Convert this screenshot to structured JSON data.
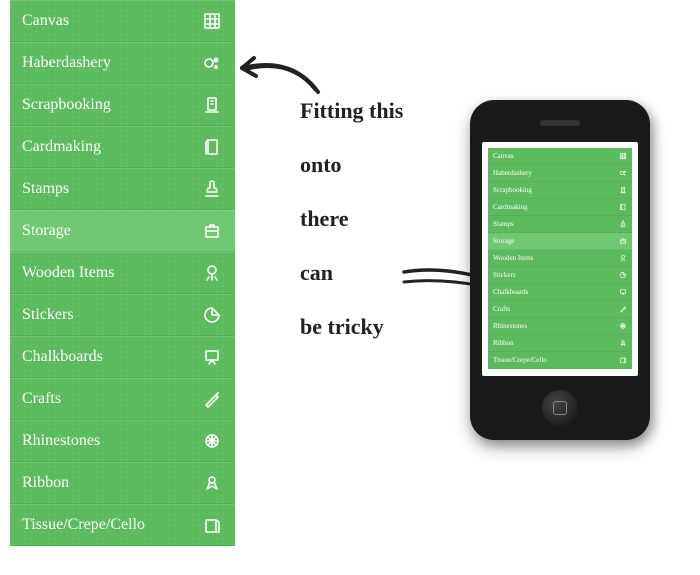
{
  "annotation": {
    "line1": "Fitting this",
    "line2": "onto",
    "line3": "there",
    "line4": "can",
    "line5": "be tricky"
  },
  "menu": {
    "items": [
      {
        "label": "Canvas",
        "icon": "canvas-icon"
      },
      {
        "label": "Haberdashery",
        "icon": "haberdashery-icon"
      },
      {
        "label": "Scrapbooking",
        "icon": "scrapbooking-icon"
      },
      {
        "label": "Cardmaking",
        "icon": "cardmaking-icon"
      },
      {
        "label": "Stamps",
        "icon": "stamps-icon"
      },
      {
        "label": "Storage",
        "icon": "storage-icon",
        "highlight": true
      },
      {
        "label": "Wooden Items",
        "icon": "wooden-icon"
      },
      {
        "label": "Stickers",
        "icon": "stickers-icon"
      },
      {
        "label": "Chalkboards",
        "icon": "chalkboards-icon"
      },
      {
        "label": "Crafts",
        "icon": "crafts-icon"
      },
      {
        "label": "Rhinestones",
        "icon": "rhinestones-icon"
      },
      {
        "label": "Ribbon",
        "icon": "ribbon-icon"
      },
      {
        "label": "Tissue/Crepe/Cello",
        "icon": "tissue-icon"
      }
    ]
  },
  "colors": {
    "menu_bg": "#5cbb5c",
    "menu_highlight": "#70c870",
    "text": "#ffffff"
  }
}
